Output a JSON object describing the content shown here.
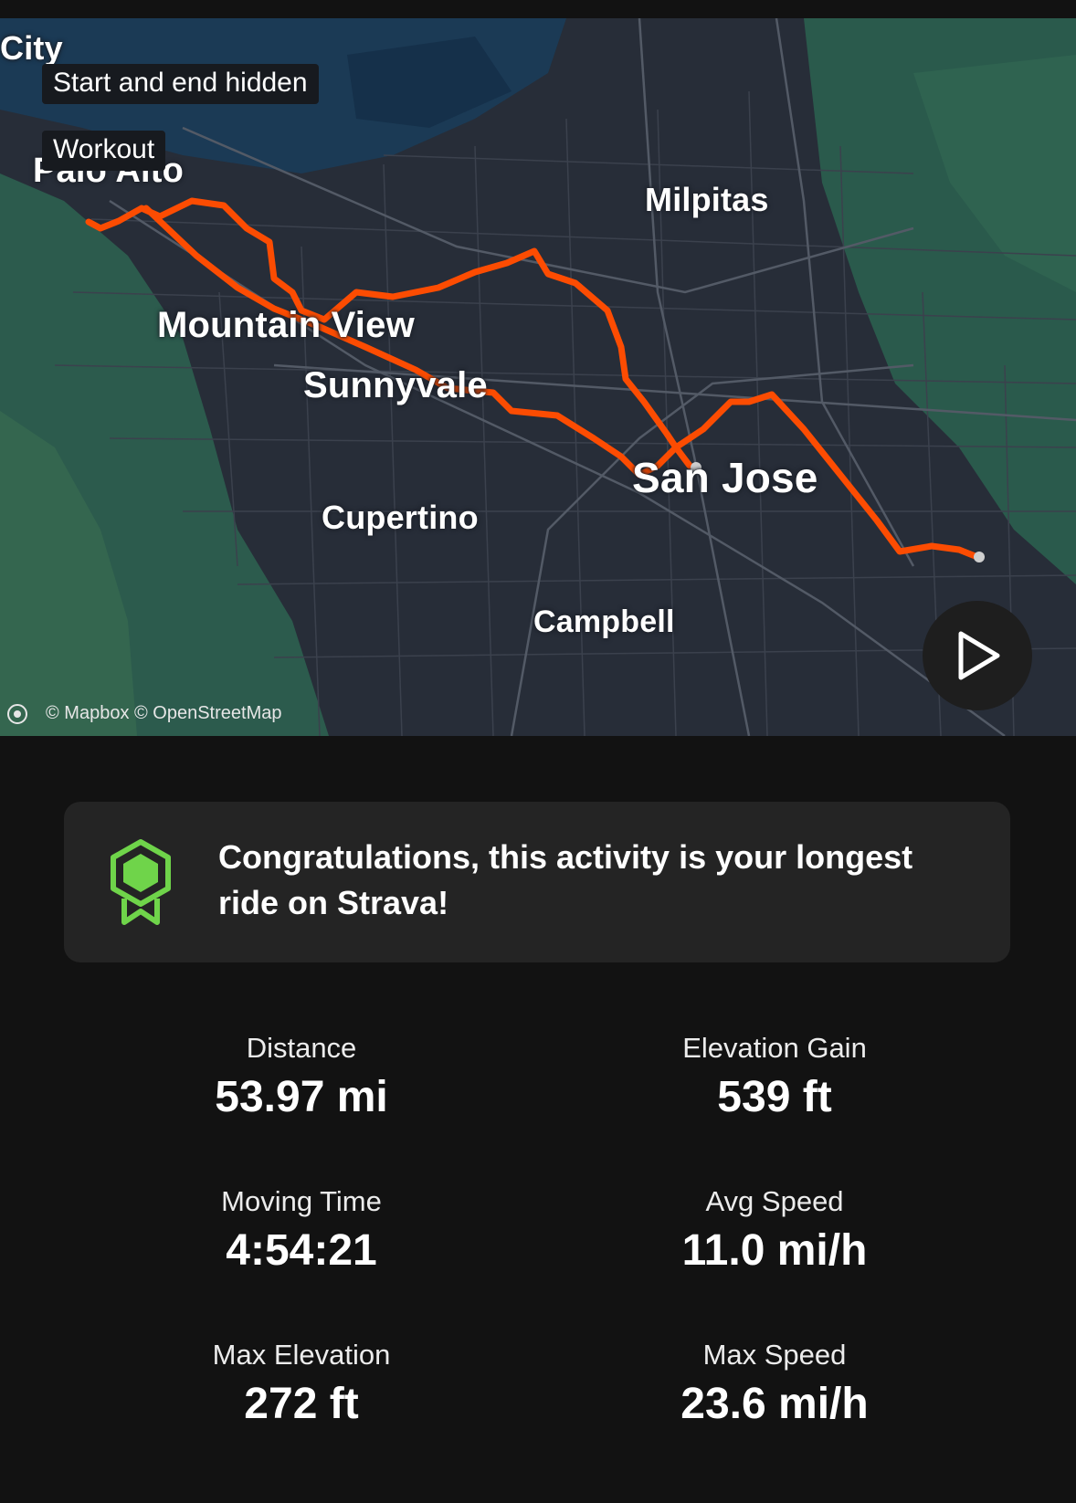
{
  "map": {
    "badges": {
      "privacy": "Start and end hidden",
      "type": "Workout"
    },
    "cities": {
      "city": "City",
      "palo_alto": "Palo Alto",
      "milpitas": "Milpitas",
      "mountain_view": "Mountain View",
      "sunnyvale": "Sunnyvale",
      "san_jose": "San Jose",
      "cupertino": "Cupertino",
      "campbell": "Campbell"
    },
    "attribution": "© Mapbox © OpenStreetMap",
    "route_color": "#fc4c02",
    "play_icon": "play-icon"
  },
  "achievement": {
    "icon": "ribbon-medal-icon",
    "accent_color": "#6fd44a",
    "text": "Congratulations, this activity is your longest ride on Strava!"
  },
  "stats": [
    {
      "label": "Distance",
      "value": "53.97 mi"
    },
    {
      "label": "Elevation Gain",
      "value": "539 ft"
    },
    {
      "label": "Moving Time",
      "value": "4:54:21"
    },
    {
      "label": "Avg Speed",
      "value": "11.0 mi/h"
    },
    {
      "label": "Max Elevation",
      "value": "272 ft"
    },
    {
      "label": "Max Speed",
      "value": "23.6 mi/h"
    }
  ]
}
